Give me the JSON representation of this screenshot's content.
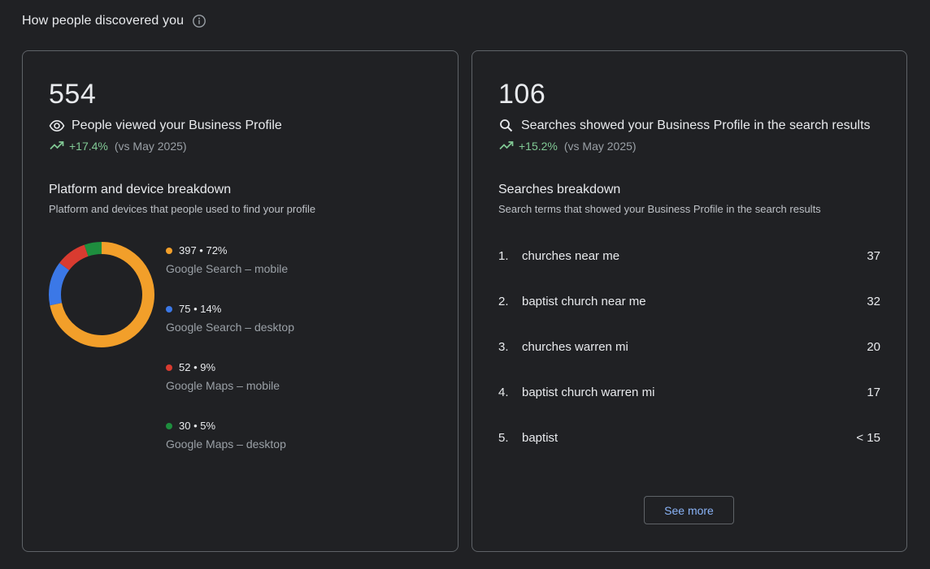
{
  "section": {
    "title": "How people discovered you",
    "info_icon": "info-icon"
  },
  "profile_views": {
    "value": "554",
    "label": "People viewed your Business Profile",
    "icon": "eye-icon",
    "trend": {
      "percent": "+17.4%",
      "comparison": "(vs May 2025)",
      "icon": "trending-up-icon"
    },
    "breakdown": {
      "title": "Platform and device breakdown",
      "description": "Platform and devices that people used to find your profile",
      "items": [
        {
          "stat": "397 • 72%",
          "label": "Google Search – mobile",
          "value": 397,
          "color": "#f29f2a"
        },
        {
          "stat": "75 • 14%",
          "label": "Google Search – desktop",
          "value": 75,
          "color": "#3b78e7"
        },
        {
          "stat": "52 • 9%",
          "label": "Google Maps – mobile",
          "value": 52,
          "color": "#d93b30"
        },
        {
          "stat": "30 • 5%",
          "label": "Google Maps – desktop",
          "value": 30,
          "color": "#1e8e3e"
        }
      ]
    }
  },
  "searches": {
    "value": "106",
    "label": "Searches showed your Business Profile in the search results",
    "icon": "search-icon",
    "trend": {
      "percent": "+15.2%",
      "comparison": "(vs May 2025)",
      "icon": "trending-up-icon"
    },
    "breakdown": {
      "title": "Searches breakdown",
      "description": "Search terms that showed your Business Profile in the search results",
      "items": [
        {
          "rank": "1.",
          "term": "churches near me",
          "count": "37"
        },
        {
          "rank": "2.",
          "term": "baptist church near me",
          "count": "32"
        },
        {
          "rank": "3.",
          "term": "churches warren mi",
          "count": "20"
        },
        {
          "rank": "4.",
          "term": "baptist church warren mi",
          "count": "17"
        },
        {
          "rank": "5.",
          "term": "baptist",
          "count": "< 15"
        }
      ]
    },
    "see_more_label": "See more"
  }
}
